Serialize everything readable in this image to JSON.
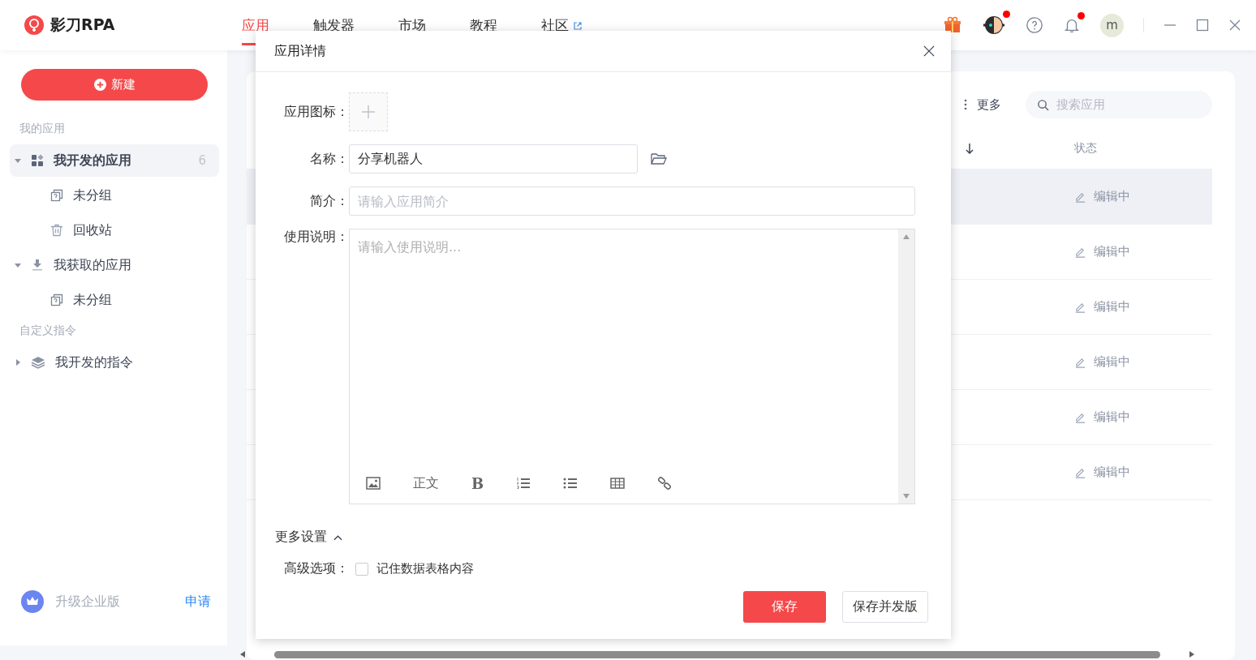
{
  "app": {
    "name": "影刀RPA"
  },
  "nav_tabs": [
    {
      "label": "应用",
      "selected": true,
      "external": false
    },
    {
      "label": "触发器",
      "selected": false,
      "external": false
    },
    {
      "label": "市场",
      "selected": false,
      "external": false
    },
    {
      "label": "教程",
      "selected": false,
      "external": false
    },
    {
      "label": "社区",
      "selected": false,
      "external": true
    }
  ],
  "header_icons": [
    {
      "kind": "gift",
      "dot": false
    },
    {
      "kind": "assistant",
      "dot": true
    },
    {
      "kind": "help",
      "dot": false
    },
    {
      "kind": "bell",
      "dot": true
    }
  ],
  "avatar": "m",
  "sidebar": {
    "new_button": "新建",
    "sections": [
      {
        "title": "我的应用",
        "items": [
          {
            "label": "我开发的应用",
            "kind": "apps",
            "count": "6",
            "selected": true,
            "expanded": true,
            "children": [
              {
                "label": "未分组",
                "kind": "group",
                "selected": false
              },
              {
                "label": "回收站",
                "kind": "trash",
                "selected": false
              }
            ]
          },
          {
            "label": "我获取的应用",
            "kind": "download",
            "selected": false,
            "expanded": true,
            "children": [
              {
                "label": "未分组",
                "kind": "group",
                "selected": false
              }
            ]
          }
        ]
      },
      {
        "title": "自定义指令",
        "items": [
          {
            "label": "我开发的指令",
            "kind": "layers",
            "selected": false,
            "expanded": false
          }
        ]
      }
    ],
    "upgrade": {
      "label": "升级企业版",
      "link": "申请"
    }
  },
  "toolbar": {
    "more": "更多",
    "search": {
      "placeholder": "搜索应用"
    }
  },
  "table": {
    "columns": [
      "状态"
    ],
    "rows": [
      {
        "status": "编辑中",
        "selected": true
      },
      {
        "status": "编辑中",
        "selected": false
      },
      {
        "status": "编辑中",
        "selected": false
      },
      {
        "status": "编辑中",
        "selected": false
      },
      {
        "status": "编辑中",
        "selected": false
      },
      {
        "status": "编辑中",
        "selected": false
      }
    ]
  },
  "dialog": {
    "title": "应用详情",
    "icon_label": "应用图标：",
    "name": {
      "label": "名称：",
      "value": "分享机器人"
    },
    "intro": {
      "label": "简介：",
      "placeholder": "请输入应用简介"
    },
    "usage": {
      "label": "使用说明：",
      "placeholder": "请输入使用说明...",
      "toolbar": [
        {
          "kind": "image"
        },
        {
          "kind": "text",
          "label": "正文"
        },
        {
          "kind": "bold",
          "label": "B"
        },
        {
          "kind": "ol"
        },
        {
          "kind": "ul"
        },
        {
          "kind": "table"
        },
        {
          "kind": "link"
        }
      ]
    },
    "more_settings": {
      "label": "更多设置",
      "expanded": true
    },
    "advanced": {
      "label": "高级选项：",
      "option": {
        "label": "记住数据表格内容",
        "checked": false
      }
    },
    "buttons": [
      {
        "label": "保存",
        "kind": "primary"
      },
      {
        "label": "保存并发版",
        "kind": "default"
      }
    ]
  }
}
